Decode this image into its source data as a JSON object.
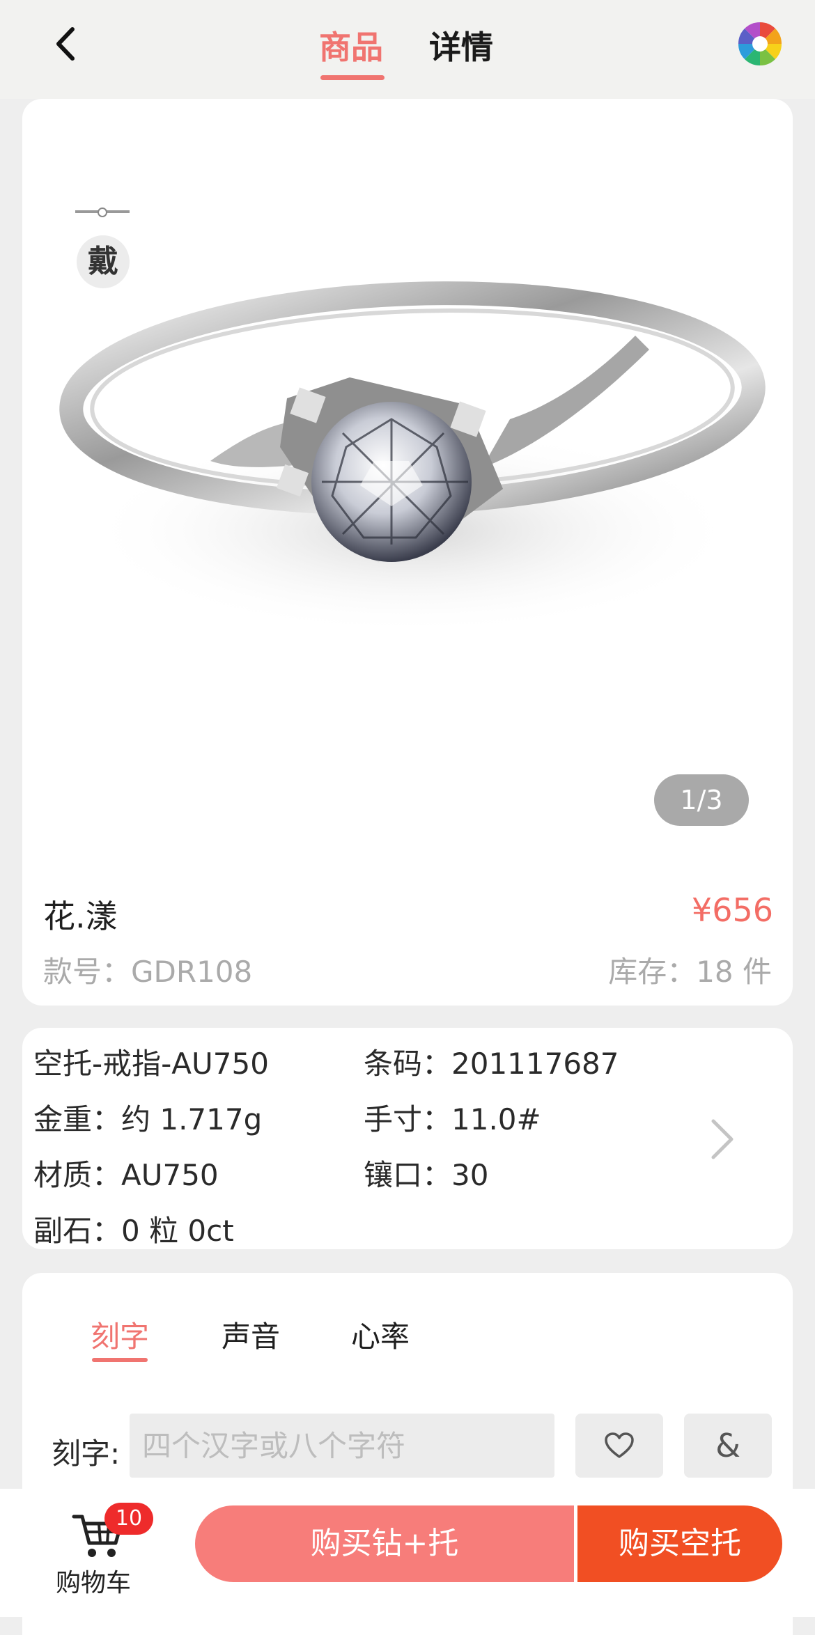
{
  "header": {
    "tabs": [
      {
        "label": "商品",
        "active": true
      },
      {
        "label": "详情",
        "active": false
      }
    ],
    "back_icon": "chevron-left-icon",
    "camera_icon": "aperture-icon"
  },
  "gallery": {
    "wear_badge": "戴",
    "pager": "1/3"
  },
  "product": {
    "name": "花.漾",
    "price": "¥656",
    "code_label": "款号：",
    "code": "GDR108",
    "stock_label": "库存：",
    "stock": "18 件"
  },
  "specs": {
    "col1": [
      "空托-戒指-AU750",
      "金重：约 1.717g",
      "材质：AU750",
      "副石：0 粒 0ct"
    ],
    "col2": [
      "条码：201117687",
      "手寸：11.0#",
      "镶口：30"
    ]
  },
  "engraving": {
    "tabs": [
      "刻字",
      "声音",
      "心率"
    ],
    "active_tab": 0,
    "label": "刻字:",
    "placeholder": "四个汉字或八个字符",
    "value": "",
    "heart_icon": "heart-icon",
    "amp_label": "&"
  },
  "bottom": {
    "cart_label": "购物车",
    "cart_count": "10",
    "buy_set": "购买钻+托",
    "buy_empty": "购买空托"
  },
  "colors": {
    "accent": "#f07470",
    "price": "#f36d65",
    "buy_set_bg": "#f77d7a",
    "buy_empty_bg": "#f14f23",
    "badge": "#ee2b2b"
  }
}
